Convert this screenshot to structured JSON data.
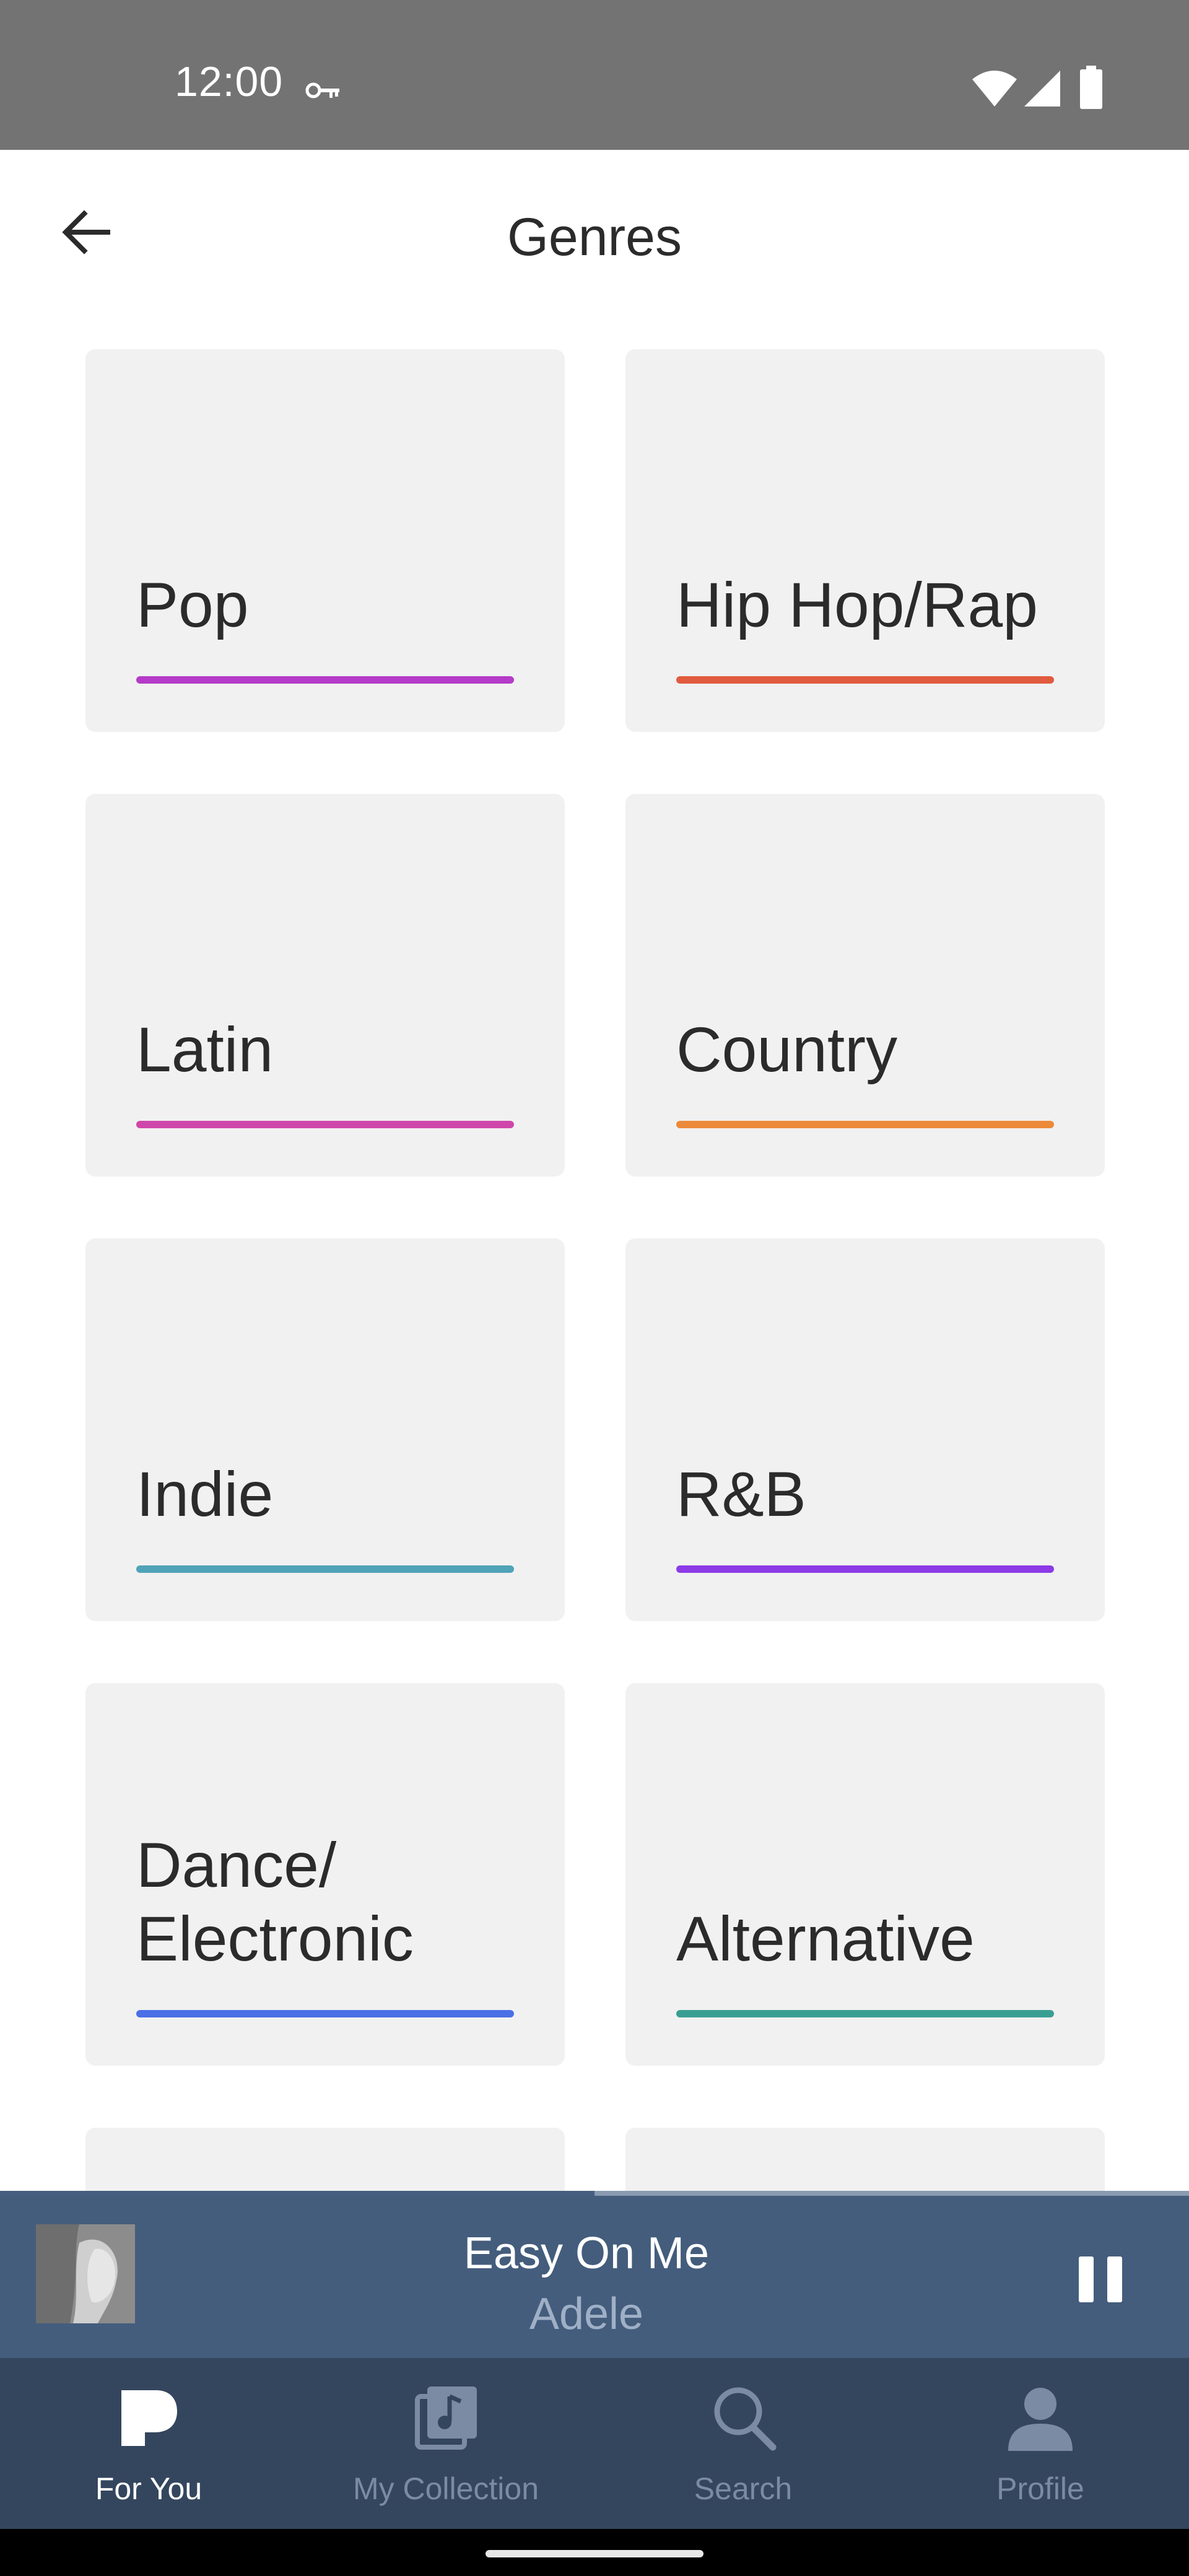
{
  "status_bar": {
    "time": "12:00",
    "icons": [
      "key-icon",
      "wifi-icon",
      "signal-icon",
      "battery-icon"
    ]
  },
  "app_bar": {
    "title": "Genres",
    "back_icon": "arrow-left-icon"
  },
  "genres": [
    {
      "label": "Pop",
      "color": "#b43bc7"
    },
    {
      "label": "Hip Hop/Rap",
      "color": "#e15b3f"
    },
    {
      "label": "Latin",
      "color": "#cf46ab"
    },
    {
      "label": "Country",
      "color": "#ec8a3a"
    },
    {
      "label": "Indie",
      "color": "#4fa3b8"
    },
    {
      "label": "R&B",
      "color": "#8c3ae6"
    },
    {
      "label": "Dance/\nElectronic",
      "color": "#4a6fe6"
    },
    {
      "label": "Alternative",
      "color": "#3a9e92"
    }
  ],
  "now_playing": {
    "title": "Easy On Me",
    "artist": "Adele",
    "progress": 0.5,
    "pause_icon": "pause-icon"
  },
  "bottom_nav": {
    "items": [
      {
        "label": "For You",
        "icon": "pandora-p-icon",
        "active": true
      },
      {
        "label": "My Collection",
        "icon": "collection-icon",
        "active": false
      },
      {
        "label": "Search",
        "icon": "search-icon",
        "active": false
      },
      {
        "label": "Profile",
        "icon": "profile-icon",
        "active": false
      }
    ]
  },
  "colors": {
    "status_bar": "#737373",
    "card_background": "#f1f1f1",
    "mini_player": "#445d7d",
    "bottom_nav": "#34465e",
    "nav_inactive": "#7b8ba3"
  }
}
